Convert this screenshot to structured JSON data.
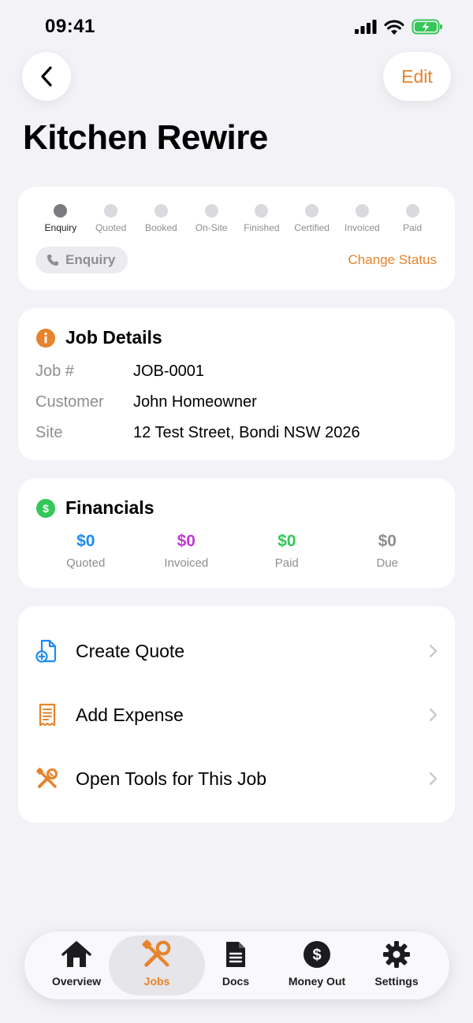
{
  "status_bar": {
    "time": "09:41"
  },
  "nav": {
    "edit_label": "Edit"
  },
  "page": {
    "title": "Kitchen Rewire"
  },
  "progress": {
    "steps": [
      {
        "label": "Enquiry",
        "active": true
      },
      {
        "label": "Quoted",
        "active": false
      },
      {
        "label": "Booked",
        "active": false
      },
      {
        "label": "On-Site",
        "active": false
      },
      {
        "label": "Finished",
        "active": false
      },
      {
        "label": "Certified",
        "active": false
      },
      {
        "label": "Invoiced",
        "active": false
      },
      {
        "label": "Paid",
        "active": false
      }
    ],
    "current_status": "Enquiry",
    "change_status_label": "Change Status"
  },
  "job_details": {
    "title": "Job Details",
    "icon": "info-icon",
    "rows": [
      {
        "label": "Job #",
        "value": "JOB-0001"
      },
      {
        "label": "Customer",
        "value": "John Homeowner"
      },
      {
        "label": "Site",
        "value": "12 Test Street, Bondi NSW 2026"
      }
    ]
  },
  "financials": {
    "title": "Financials",
    "icon": "dollar-icon",
    "items": [
      {
        "amount": "$0",
        "label": "Quoted",
        "color": "#1a8cf0"
      },
      {
        "amount": "$0",
        "label": "Invoiced",
        "color": "#c03ad6"
      },
      {
        "amount": "$0",
        "label": "Paid",
        "color": "#34c759"
      },
      {
        "amount": "$0",
        "label": "Due",
        "color": "#8e8e93"
      }
    ]
  },
  "actions": [
    {
      "label": "Create Quote",
      "icon": "document-plus-icon"
    },
    {
      "label": "Add Expense",
      "icon": "receipt-icon"
    },
    {
      "label": "Open Tools for This Job",
      "icon": "tools-icon"
    }
  ],
  "tab_bar": {
    "tabs": [
      {
        "label": "Overview",
        "icon": "house-icon",
        "active": false
      },
      {
        "label": "Jobs",
        "icon": "tools-icon",
        "active": true
      },
      {
        "label": "Docs",
        "icon": "document-icon",
        "active": false
      },
      {
        "label": "Money Out",
        "icon": "dollar-circle-icon",
        "active": false
      },
      {
        "label": "Settings",
        "icon": "gear-icon",
        "active": false
      }
    ]
  },
  "colors": {
    "accent": "#e6832b",
    "background": "#f2f2f7"
  }
}
